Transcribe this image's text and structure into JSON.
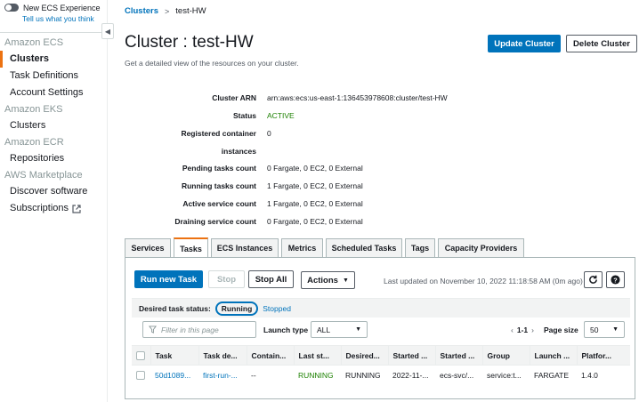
{
  "sidebar": {
    "toggle_label": "New ECS Experience",
    "tell_link": "Tell us what you think",
    "sections": [
      {
        "title": "Amazon ECS",
        "items": [
          "Clusters",
          "Task Definitions",
          "Account Settings"
        ]
      },
      {
        "title": "Amazon EKS",
        "items": [
          "Clusters"
        ]
      },
      {
        "title": "Amazon ECR",
        "items": [
          "Repositories"
        ]
      },
      {
        "title": "AWS Marketplace",
        "items": [
          "Discover software",
          "Subscriptions"
        ]
      }
    ]
  },
  "breadcrumb": {
    "parent": "Clusters",
    "separator": ">",
    "current": "test-HW"
  },
  "header": {
    "title": "Cluster : test-HW",
    "description": "Get a detailed view of the resources on your cluster.",
    "update_button": "Update Cluster",
    "delete_button": "Delete Cluster"
  },
  "details": {
    "cluster_arn_label": "Cluster ARN",
    "cluster_arn": "arn:aws:ecs:us-east-1:136453978608:cluster/test-HW",
    "status_label": "Status",
    "status": "ACTIVE",
    "registered_label_1": "Registered container",
    "registered_label_2": "instances",
    "registered": "0",
    "pending_label": "Pending tasks count",
    "pending": "0 Fargate, 0 EC2, 0 External",
    "running_label": "Running tasks count",
    "running": "1 Fargate, 0 EC2, 0 External",
    "active_service_label": "Active service count",
    "active_service": "1 Fargate, 0 EC2, 0 External",
    "draining_label": "Draining service count",
    "draining": "0 Fargate, 0 EC2, 0 External"
  },
  "tabs": [
    "Services",
    "Tasks",
    "ECS Instances",
    "Metrics",
    "Scheduled Tasks",
    "Tags",
    "Capacity Providers"
  ],
  "active_tab": "Tasks",
  "tasks_panel": {
    "run_new_task": "Run new Task",
    "stop": "Stop",
    "stop_all": "Stop All",
    "actions": "Actions",
    "last_updated": "Last updated on November 10, 2022 11:18:58 AM (0m ago)",
    "desired_status_label": "Desired task status:",
    "running_pill": "Running",
    "stopped_link": "Stopped",
    "filter_placeholder": "Filter in this page",
    "launch_type_label": "Launch type",
    "launch_type_value": "ALL",
    "page_label": "1-1",
    "page_size_label": "Page size",
    "page_size_value": "50",
    "columns": [
      "Task",
      "Task de...",
      "Contain...",
      "Last st...",
      "Desired...",
      "Started ...",
      "Started ...",
      "Group",
      "Launch ...",
      "Platfor..."
    ],
    "rows": [
      [
        "50d1089...",
        "first-run-...",
        "--",
        "RUNNING",
        "RUNNING",
        "2022-11-...",
        "ecs-svc/...",
        "service:t...",
        "FARGATE",
        "1.4.0"
      ]
    ]
  },
  "colors": {
    "accent": "#0073bb",
    "orange": "#ec7211",
    "green": "#1d8102"
  }
}
